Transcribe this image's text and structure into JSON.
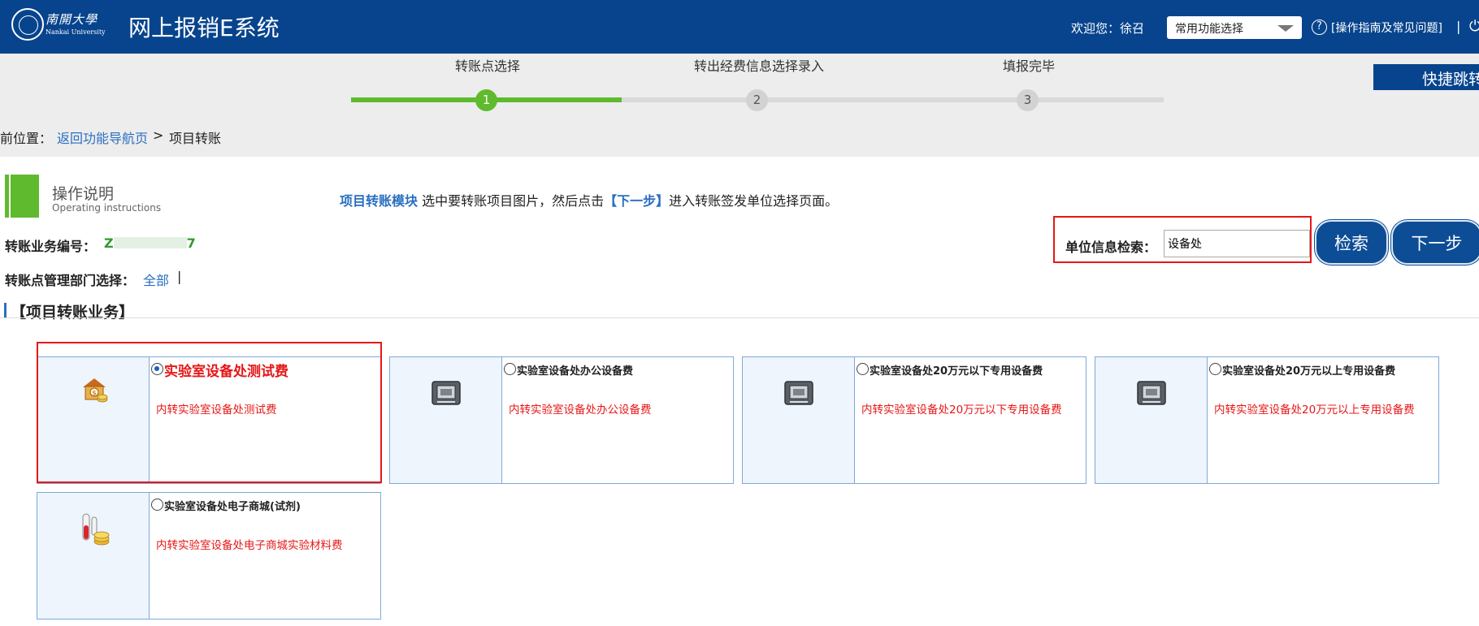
{
  "header": {
    "logo_cn": "南開大學",
    "logo_en": "Nankai University",
    "app_title": "网上报销E系统",
    "welcome": "欢迎您：徐召",
    "quick_select": "常用功能选择",
    "help_link": "[操作指南及常见问题]",
    "separator": "|"
  },
  "steps": {
    "items": [
      {
        "label": "转账点选择",
        "number": "1",
        "active": true
      },
      {
        "label": "转出经费信息选择录入",
        "number": "2",
        "active": false
      },
      {
        "label": "填报完毕",
        "number": "3",
        "active": false
      }
    ],
    "progress": 0.33,
    "jump_button": "快捷跳转"
  },
  "breadcrumb": {
    "lead": "前位置：",
    "link": "返回功能导航页",
    "separator": ">",
    "current": "项目转账"
  },
  "instructions": {
    "title": "操作说明",
    "subtitle": "Operating instructions",
    "module": "项目转账模块",
    "text_before": "选中要转账项目图片，然后点击",
    "next_ref": "【下一步】",
    "text_after": "进入转账签发单位选择页面。"
  },
  "form": {
    "serial_label": "转账业务编号：",
    "serial_prefix": "Z",
    "serial_suffix": "7",
    "dept_label": "转账点管理部门选择：",
    "dept_value": "全部",
    "dept_sep": "|",
    "search_label": "单位信息检索：",
    "search_value": "设备处",
    "search_button": "检索",
    "next_button": "下一步"
  },
  "section": {
    "title": "【项目转账业务】"
  },
  "cards": [
    {
      "title": "实验室设备处测试费",
      "desc": "内转实验室设备处测试费",
      "icon": "money-house-icon",
      "selected": true
    },
    {
      "title": "实验室设备处办公设备费",
      "desc": "内转实验室设备处办公设备费",
      "icon": "cpu-chip-icon",
      "selected": false
    },
    {
      "title": "实验室设备处20万元以下专用设备费",
      "desc": "内转实验室设备处20万元以下专用设备费",
      "icon": "cpu-chip-icon",
      "selected": false
    },
    {
      "title": "实验室设备处20万元以上专用设备费",
      "desc": "内转实验室设备处20万元以上专用设备费",
      "icon": "cpu-chip-icon",
      "selected": false
    },
    {
      "title": "实验室设备处电子商城(试剂)",
      "desc": "内转实验室设备处电子商城实验材料费",
      "icon": "test-tube-coins-icon",
      "selected": false
    }
  ],
  "colors": {
    "header_bg": "#07448d",
    "accent_green": "#5fba2e",
    "link_blue": "#2a6fc1",
    "alert_red": "#e61717"
  }
}
